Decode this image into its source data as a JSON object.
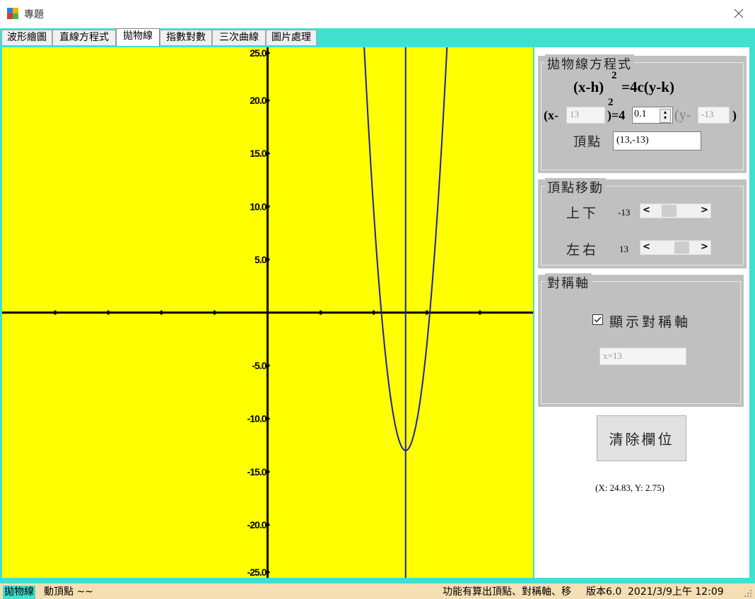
{
  "window": {
    "title": "專題"
  },
  "tabs": [
    {
      "label": "波形繪圖"
    },
    {
      "label": "直線方程式"
    },
    {
      "label": "拋物線"
    },
    {
      "label": "指數對數"
    },
    {
      "label": "三次曲線"
    },
    {
      "label": "圖片處理"
    }
  ],
  "active_tab": "拋物線",
  "plot": {
    "xlim": [
      -25,
      25
    ],
    "ylim": [
      -25,
      25
    ],
    "y_tick_labels": [
      "25.0",
      "20.0",
      "15.0",
      "10.0",
      "5.0",
      "-5.0",
      "-10.0",
      "-15.0",
      "-20.0",
      "-25.0"
    ],
    "x_ticks": [
      -20,
      -15,
      -10,
      -5,
      5,
      10,
      15,
      20
    ],
    "parabola": {
      "h": 13,
      "k": -13,
      "c": 0.1
    },
    "axis_of_symmetry_x": 13,
    "colors": {
      "background": "#ffff00",
      "axes": "#000000",
      "curve": "#1f1fa8"
    }
  },
  "equation_group": {
    "title": "拋物線方程式",
    "formula_lhs": "(x-h)",
    "formula_exp": "2",
    "formula_rhs": "=4c(y-k)",
    "row_open": "(x-",
    "h_value": "13",
    "row_exp": "2",
    "row_mid": ")=4",
    "c_value": "0.1",
    "row_y_open": "(y-",
    "k_value": "-13",
    "row_close": ")",
    "vertex_label": "頂點",
    "vertex_value": "(13,-13)"
  },
  "move_group": {
    "title": "頂點移動",
    "updown_label": "上下",
    "updown_value": "-13",
    "leftright_label": "左右",
    "leftright_value": "13"
  },
  "symmetry_group": {
    "title": "對稱軸",
    "checkbox_label": "顯示對稱軸",
    "checked": true,
    "axis_text": "x=13"
  },
  "clear_button": "清除欄位",
  "coords_readout": "(X: 24.83, Y: 2.75)",
  "status": {
    "item1": "拋物線",
    "item2": "動頂點 ~~",
    "item3": "功能有算出頂點、對稱軸、移",
    "item4": "版本6.0",
    "item5": "2021/3/9上午 12:09"
  }
}
